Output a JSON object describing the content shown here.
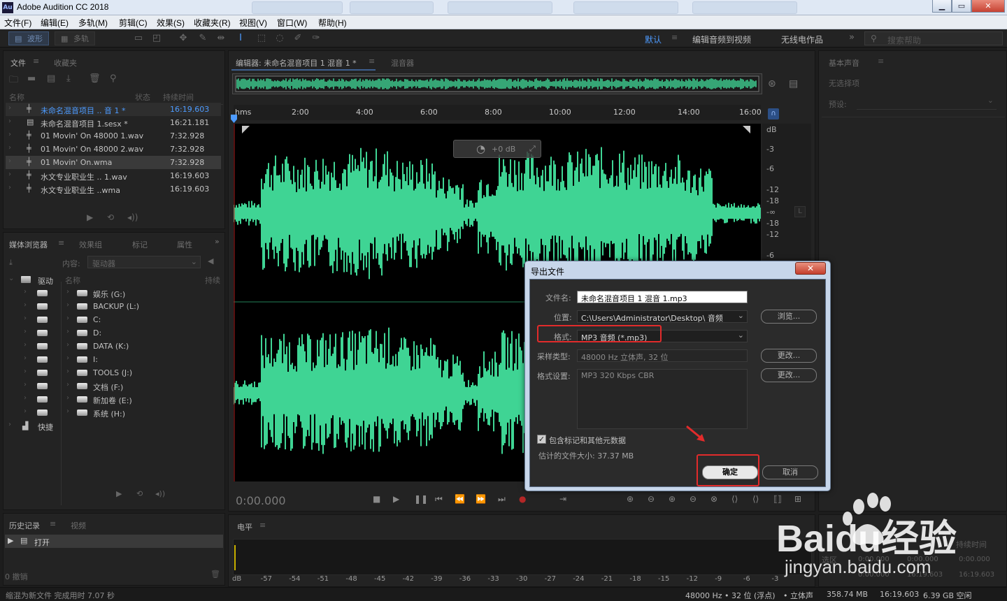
{
  "titlebar": {
    "app_title": "Adobe Audition CC 2018",
    "minimize": "▁",
    "maximize": "▭",
    "close": "✕"
  },
  "menu": [
    "文件(F)",
    "编辑(E)",
    "多轨(M)",
    "剪辑(C)",
    "效果(S)",
    "收藏夹(R)",
    "视图(V)",
    "窗口(W)",
    "帮助(H)"
  ],
  "toolbar": {
    "mode_waveform": "波形",
    "mode_multitrack": "多轨",
    "workspaces": [
      "默认",
      "编辑音频到视频",
      "无线电作品"
    ],
    "active_workspace": "默认",
    "search_placeholder": "搜索帮助"
  },
  "files_panel": {
    "tabs": [
      "文件",
      "收藏夹"
    ],
    "col_name": "名称",
    "col_status": "状态",
    "col_duration": "持续时间",
    "rows": [
      {
        "name": "未命名混音项目 .. 音 1 *",
        "duration": "16:19.603",
        "icon": "waveform-icon"
      },
      {
        "name": "未命名混音项目 1.sesx *",
        "duration": "16:21.181",
        "icon": "multitrack-icon"
      },
      {
        "name": "01 Movin' On 48000 1.wav",
        "duration": "7:32.928",
        "icon": "waveform-icon"
      },
      {
        "name": "01 Movin' On 48000 2.wav",
        "duration": "7:32.928",
        "icon": "waveform-icon"
      },
      {
        "name": "01 Movin' On.wma",
        "duration": "7:32.928",
        "icon": "waveform-icon"
      },
      {
        "name": "水文专业职业生 .. 1.wav",
        "duration": "16:19.603",
        "icon": "waveform-icon"
      },
      {
        "name": "水文专业职业生 ..wma",
        "duration": "16:19.603",
        "icon": "waveform-icon"
      }
    ]
  },
  "media_panel": {
    "tabs": [
      "媒体浏览器",
      "效果组",
      "标记",
      "属性"
    ],
    "content_label": "内容:",
    "content_value": "驱动器",
    "col_name": "名称",
    "col_duration": "持续",
    "tree": [
      "驱动",
      "快捷"
    ],
    "drives": [
      "娱乐 (G:)",
      "BACKUP (L:)",
      "C:",
      "D:",
      "DATA (K:)",
      "I:",
      "TOOLS (J:)",
      "文档 (F:)",
      "新加卷 (E:)",
      "系统 (H:)"
    ]
  },
  "history_panel": {
    "tabs": [
      "历史记录",
      "视频"
    ],
    "items": [
      "打开"
    ],
    "undo_count": "0 撤销"
  },
  "editor": {
    "tab_editor": "编辑器: 未命名混音项目 1 混音 1 *",
    "tab_mixer": "混音器",
    "ruler_unit": "hms",
    "ruler_ticks": [
      "2:00",
      "4:00",
      "6:00",
      "8:00",
      "10:00",
      "12:00",
      "14:00",
      "16:00"
    ],
    "db_unit": "dB",
    "db_ticks_top": [
      "-3",
      "-6",
      "-12",
      "-18",
      "-∞",
      "-18",
      "-12",
      "-6"
    ],
    "hud_gain": "+0 dB",
    "current_time": "0:00.000",
    "channel_label": "L"
  },
  "levels_panel": {
    "title": "电平",
    "scale": [
      "dB",
      "-57",
      "-54",
      "-51",
      "-48",
      "-45",
      "-42",
      "-39",
      "-36",
      "-33",
      "-30",
      "-27",
      "-24",
      "-21",
      "-18",
      "-15",
      "-12",
      "-9",
      "-6",
      "-3"
    ]
  },
  "right_panel": {
    "title": "基本声音",
    "no_selection": "无选择项",
    "preset_label": "预设:",
    "selection_header": "持续时间",
    "selection_label": "选区",
    "selection_values": [
      "0:00.000",
      "0:00.000",
      "0:00.000"
    ],
    "view_values": [
      "0:00.000",
      "16:19.603",
      "16:19.603"
    ]
  },
  "export_dialog": {
    "title": "导出文件",
    "close": "✕",
    "filename_label": "文件名:",
    "filename_value": "未命名混音项目 1 混音 1.mp3",
    "location_label": "位置:",
    "location_value": "C:\\Users\\Administrator\\Desktop\\ 音频",
    "browse_button": "浏览...",
    "format_label": "格式:",
    "format_value": "MP3 音频 (*.mp3)",
    "sample_type_label": "采样类型:",
    "sample_type_value": "48000 Hz 立体声, 32 位",
    "change_button": "更改...",
    "format_settings_label": "格式设置:",
    "format_settings_value": "MP3 320 Kbps CBR",
    "change_button_2": "更改...",
    "include_markers_label": "包含标记和其他元数据",
    "include_markers_checked": true,
    "estimated_size": "估计的文件大小: 37.37 MB",
    "ok_button": "确定",
    "cancel_button": "取消"
  },
  "statusbar": {
    "left": "缩混为新文件 完成用时 7.07 秒",
    "sample_rate": "48000 Hz • 32 位 (浮点)",
    "channels": "立体声",
    "size": "358.74 MB",
    "duration": "16:19.603",
    "free": "6.39 GB 空闲"
  },
  "watermark": {
    "text": "Baidu经验",
    "url": "jingyan.baidu.com"
  },
  "colors": {
    "waveform": "#3fd494",
    "accent_blue": "#4d9bff",
    "highlight_red": "#e22b2b",
    "background": "#1d1d1d"
  }
}
